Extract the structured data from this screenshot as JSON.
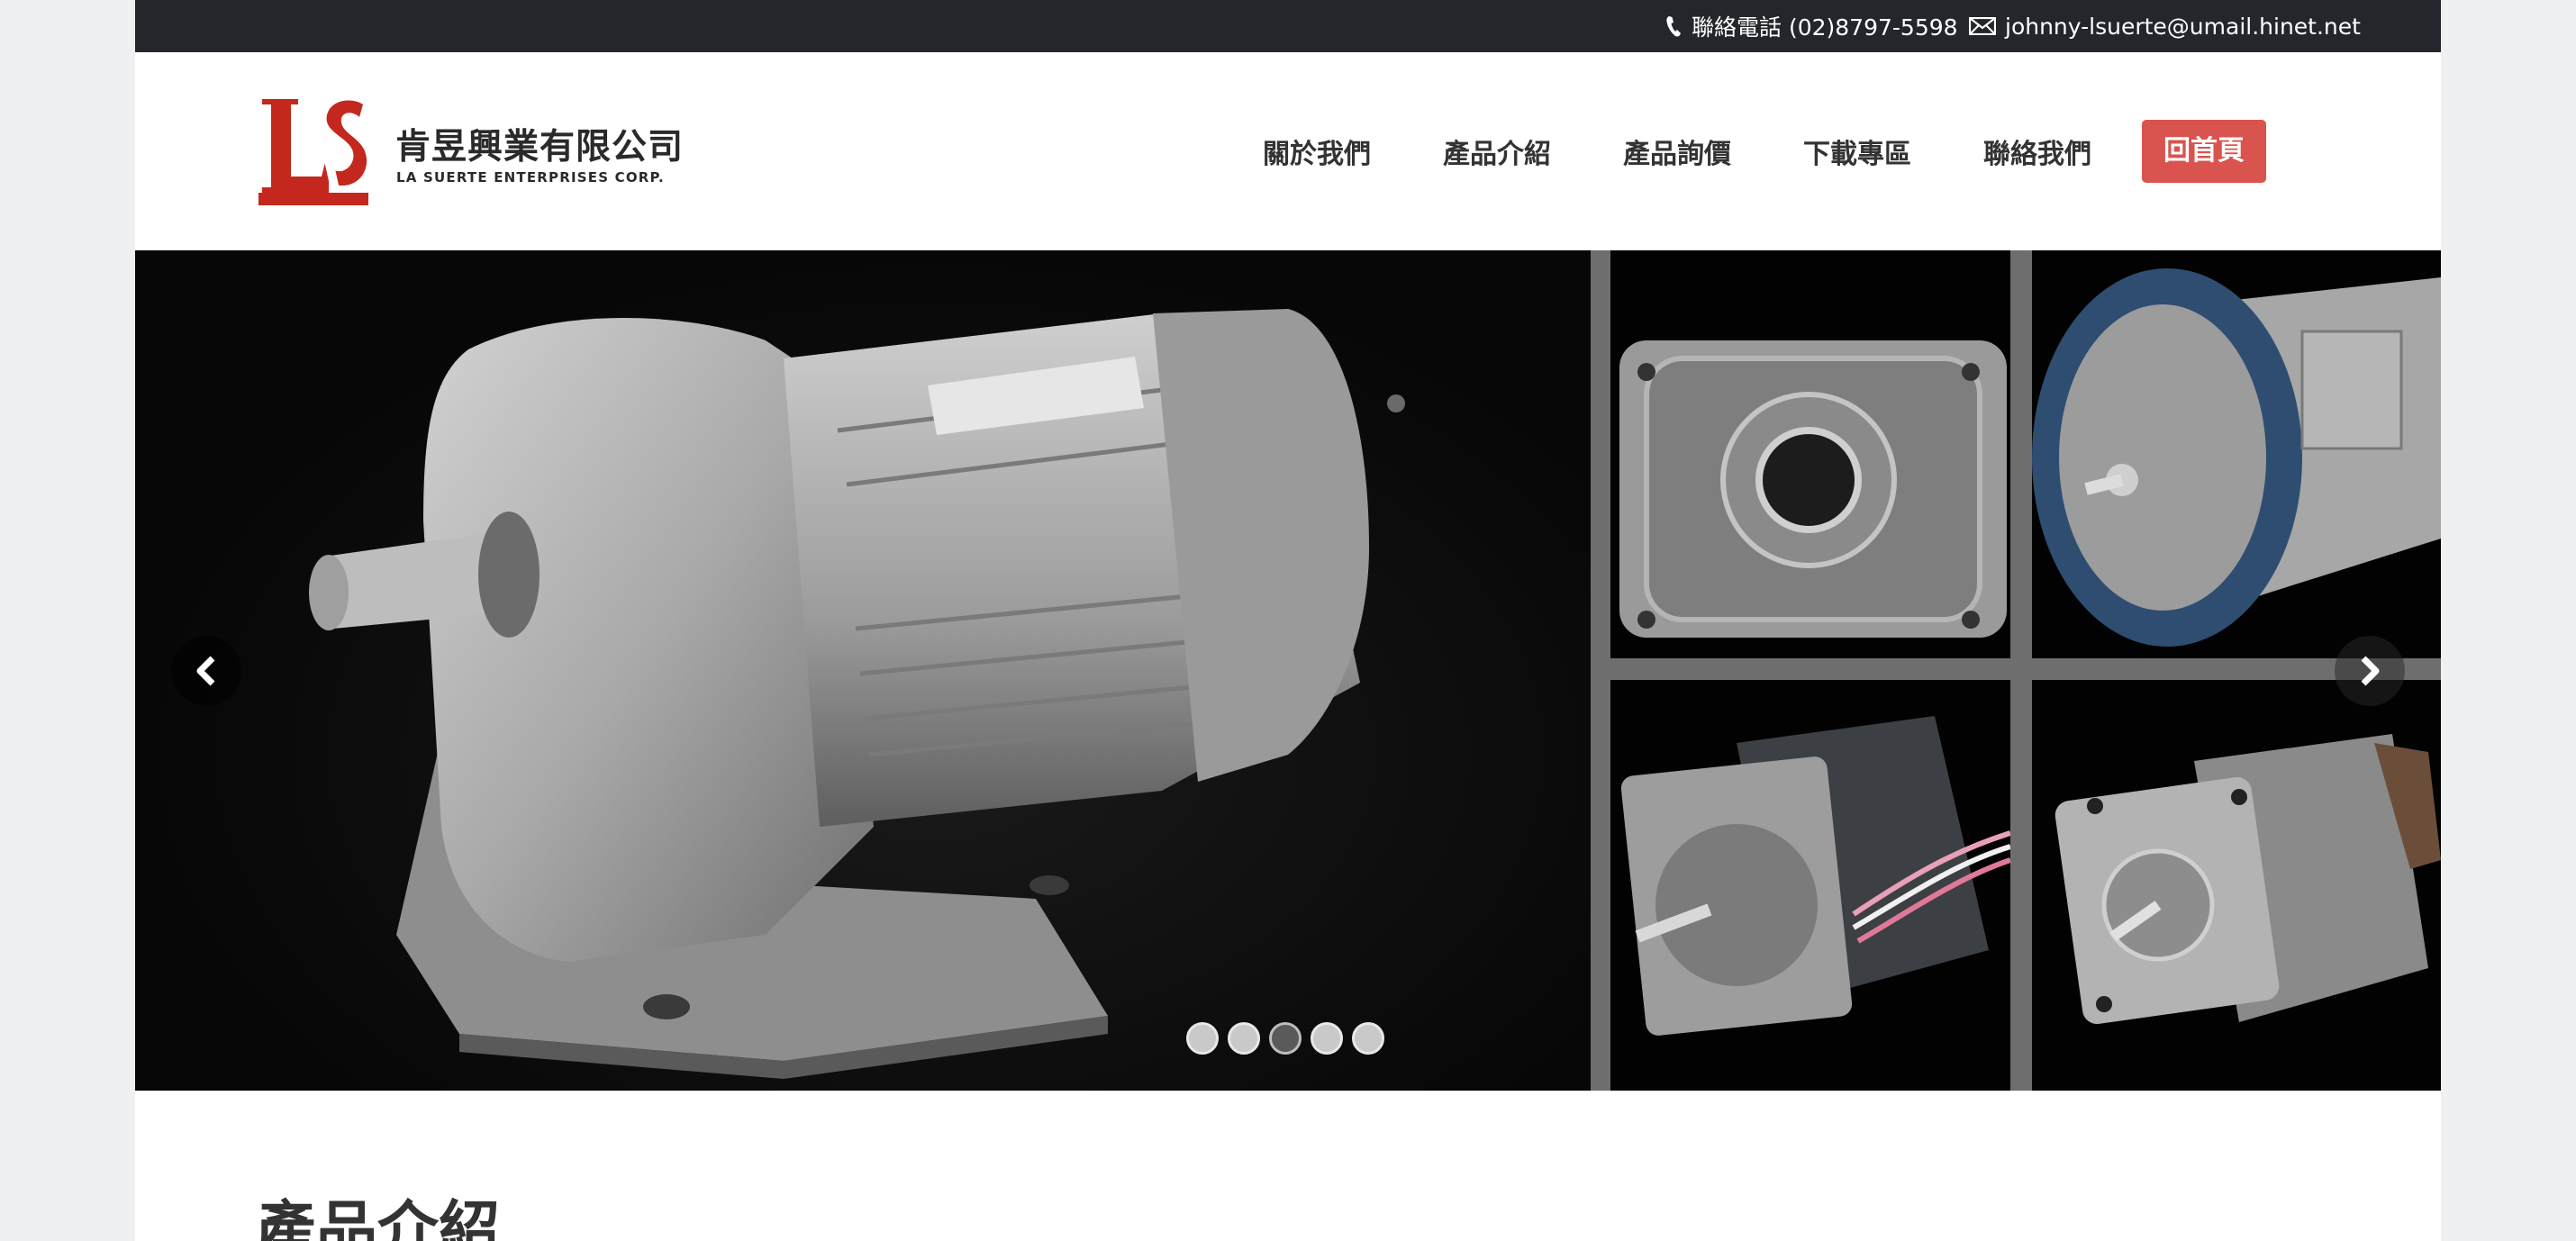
{
  "topbar": {
    "phone_icon": "phone-icon",
    "phone_text": "聯絡電話 (02)8797-5598",
    "mail_icon": "envelope-icon",
    "email_text": "johnny-lsuerte@umail.hinet.net"
  },
  "header": {
    "logo_mark": "LS",
    "logo_cn": "肯昱興業有限公司",
    "logo_en": "LA SUERTE ENTERPRISES CORP.",
    "brand_color": "#c4271d"
  },
  "nav": {
    "items": [
      {
        "label": "關於我們"
      },
      {
        "label": "產品介紹"
      },
      {
        "label": "產品詢價"
      },
      {
        "label": "下載專區"
      },
      {
        "label": "聯絡我們"
      }
    ],
    "home_label": "回首頁",
    "home_color": "#d9534f"
  },
  "carousel": {
    "prev_icon": "chevron-left-icon",
    "next_icon": "chevron-right-icon",
    "slide_count": 5,
    "active_slide": 3
  },
  "section": {
    "title": "產品介紹"
  }
}
